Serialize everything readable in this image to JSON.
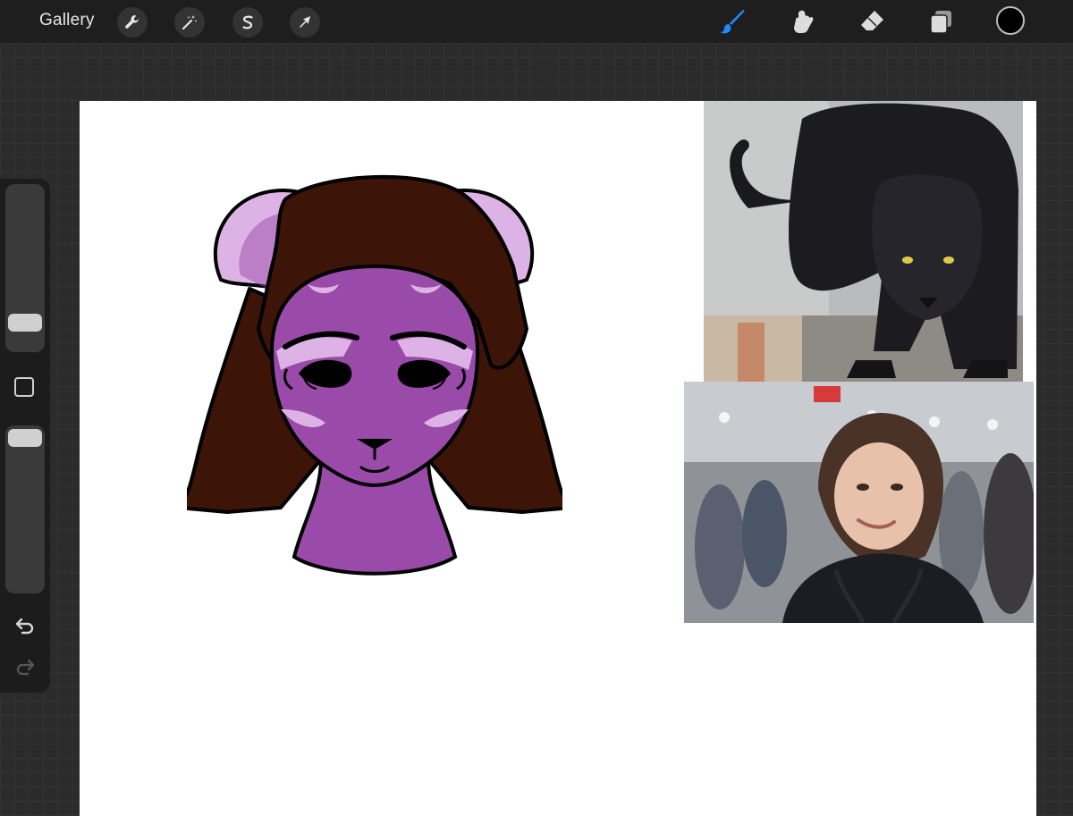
{
  "toolbar": {
    "gallery_label": "Gallery",
    "left_tools": [
      "wrench-icon",
      "magic-wand-icon",
      "selection-s-icon",
      "transform-arrow-icon"
    ],
    "right_tools": [
      "brush-icon",
      "smudge-icon",
      "eraser-icon",
      "layers-icon"
    ],
    "active_tool": "brush-icon",
    "active_color": "#000000",
    "accent": "#1e8cff"
  },
  "sidebar": {
    "brush_size_level": 0.21,
    "opacity_level": 0.94
  },
  "canvas": {
    "background": "#ffffff",
    "reference_images": [
      "black-panther-photo",
      "smiling-nurse-photo"
    ],
    "drawing_colors": {
      "skin": "#9a4aa8",
      "skin_light": "#ddb3e6",
      "hair": "#3d1408",
      "outline": "#000000"
    }
  }
}
